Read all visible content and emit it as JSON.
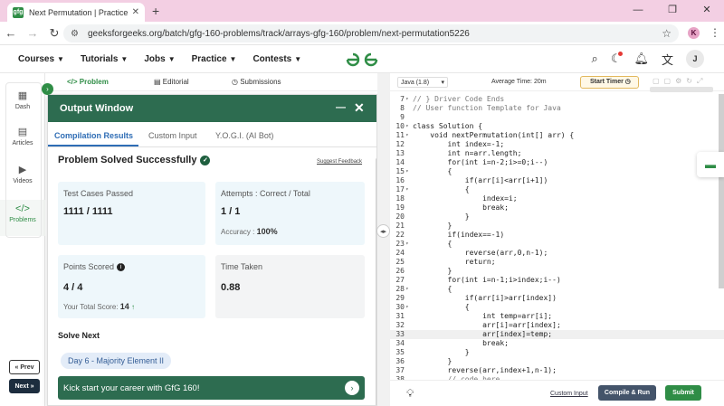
{
  "browser": {
    "tab_title": "Next Permutation | Practice | Ge",
    "favicon_text": "gfg",
    "url": "geeksforgeeks.org/batch/gfg-160-problems/track/arrays-gfg-160/problem/next-permutation5226",
    "profile_initial": "K"
  },
  "site_nav": {
    "menu": [
      "Courses",
      "Tutorials",
      "Jobs",
      "Practice",
      "Contests"
    ],
    "logo_text": "GfG",
    "user_initial": "J"
  },
  "rail": {
    "items": [
      "Dash",
      "Articles",
      "Videos",
      "Problems"
    ],
    "prev_label": "« Prev",
    "next_label": "Next »"
  },
  "problem_tabs": [
    "Problem",
    "Editorial",
    "Submissions"
  ],
  "output": {
    "title": "Output Window",
    "tabs": [
      "Compilation Results",
      "Custom Input",
      "Y.O.G.I. (AI Bot)"
    ],
    "status": "Problem Solved Successfully",
    "feedback": "Suggest Feedback",
    "test_cases_label": "Test Cases Passed",
    "test_cases_value": "1111 / 1111",
    "attempts_label": "Attempts : Correct / Total",
    "attempts_value": "1 / 1",
    "accuracy_label": "Accuracy :",
    "accuracy_value": "100%",
    "points_label": "Points Scored",
    "points_value": "4 / 4",
    "total_score_label": "Your Total Score:",
    "total_score_value": "14",
    "time_label": "Time Taken",
    "time_value": "0.88",
    "solve_next": "Solve Next",
    "next_problem": "Day 6 - Majority Element II",
    "banner": "Kick start your career with GfG 160!"
  },
  "editor": {
    "language": "Java (1.8)",
    "avg_time": "Average Time: 20m",
    "timer_label": "Start Timer",
    "custom_input": "Custom Input",
    "compile_run": "Compile & Run",
    "submit": "Submit",
    "lines": [
      {
        "n": "7",
        "t": "// } Driver Code Ends",
        "fold": true,
        "cls": "cm"
      },
      {
        "n": "8",
        "t": "// User function Template for Java",
        "cls": "cm"
      },
      {
        "n": "9",
        "t": ""
      },
      {
        "n": "10",
        "t": "class Solution {",
        "fold": true
      },
      {
        "n": "11",
        "t": "    void nextPermutation(int[] arr) {",
        "fold": true
      },
      {
        "n": "12",
        "t": "        int index=-1;"
      },
      {
        "n": "13",
        "t": "        int n=arr.length;"
      },
      {
        "n": "14",
        "t": "        for(int i=n-2;i>=0;i--)"
      },
      {
        "n": "15",
        "t": "        {",
        "fold": true
      },
      {
        "n": "16",
        "t": "            if(arr[i]<arr[i+1])"
      },
      {
        "n": "17",
        "t": "            {",
        "fold": true
      },
      {
        "n": "18",
        "t": "                index=i;"
      },
      {
        "n": "19",
        "t": "                break;"
      },
      {
        "n": "20",
        "t": "            }"
      },
      {
        "n": "21",
        "t": "        }"
      },
      {
        "n": "22",
        "t": "        if(index==-1)"
      },
      {
        "n": "23",
        "t": "        {",
        "fold": true
      },
      {
        "n": "24",
        "t": "            reverse(arr,0,n-1);"
      },
      {
        "n": "25",
        "t": "            return;"
      },
      {
        "n": "26",
        "t": "        }"
      },
      {
        "n": "27",
        "t": "        for(int i=n-1;i>index;i--)"
      },
      {
        "n": "28",
        "t": "        {",
        "fold": true
      },
      {
        "n": "29",
        "t": "            if(arr[i]>arr[index])"
      },
      {
        "n": "30",
        "t": "            {",
        "fold": true
      },
      {
        "n": "31",
        "t": "                int temp=arr[i];"
      },
      {
        "n": "32",
        "t": "                arr[i]=arr[index];"
      },
      {
        "n": "33",
        "t": "                arr[index]=temp;",
        "hl": true
      },
      {
        "n": "34",
        "t": "                break;"
      },
      {
        "n": "35",
        "t": "            }"
      },
      {
        "n": "36",
        "t": "        }"
      },
      {
        "n": "37",
        "t": "        reverse(arr,index+1,n-1);"
      },
      {
        "n": "38",
        "t": "        // code here",
        "cls": "cm"
      }
    ]
  },
  "colors": {
    "brand_green": "#2f8d46",
    "header_green": "#2d6c50",
    "tab_strip": "#f3cfe3"
  }
}
